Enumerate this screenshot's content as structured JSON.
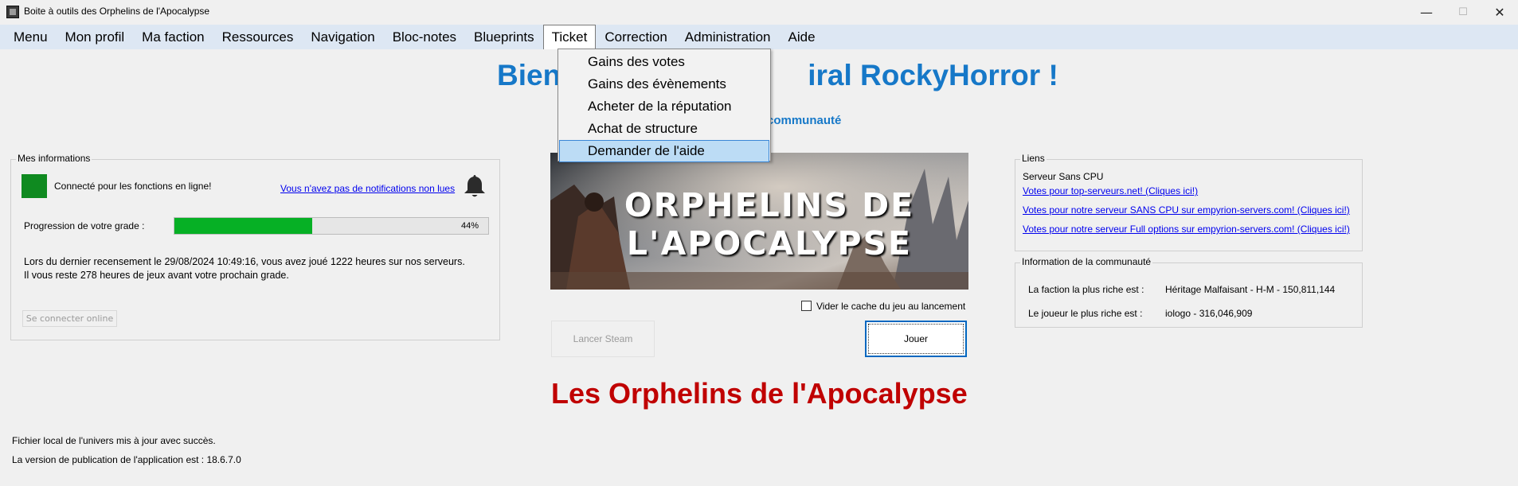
{
  "window": {
    "title": "Boite à outils des Orphelins de l'Apocalypse",
    "minimize": "—",
    "maximize": "☐",
    "close": "✕"
  },
  "menu": [
    "Menu",
    "Mon profil",
    "Ma faction",
    "Ressources",
    "Navigation",
    "Bloc-notes",
    "Blueprints",
    "Ticket",
    "Correction",
    "Administration",
    "Aide"
  ],
  "menu_open": "Ticket",
  "dropdown": {
    "items": [
      "Gains des votes",
      "Gains des évènements",
      "Acheter de la réputation",
      "Achat de structure",
      "Demander de l'aide"
    ],
    "highlighted": "Demander de l'aide"
  },
  "welcome": {
    "visible_start": "Bien",
    "visible_end": "iral RockyHorror !",
    "community_text": "communauté"
  },
  "mes_infos": {
    "title": "Mes informations",
    "status_text": "Connecté pour les fonctions en ligne!",
    "status_color": "#0f8a20",
    "notifications_link": "Vous n'avez pas de notifications non lues",
    "bell_icon": "bell-icon",
    "progress_label": "Progression de votre grade :",
    "progress_percent": 44,
    "progress_text": "44%",
    "census_line1": "Lors du dernier recensement le 29/08/2024 10:49:16, vous avez joué 1222 heures sur nos serveurs.",
    "census_line2": "Il vous reste 278 heures de jeux avant votre prochain grade.",
    "connect_button": "Se connecter online"
  },
  "banner": {
    "line1": "ORPHELINS DE",
    "line2": "L'APOCALYPSE"
  },
  "cache": {
    "label": "Vider le cache du jeu au lancement",
    "checked": false
  },
  "buttons": {
    "steam": "Lancer Steam",
    "play": "Jouer"
  },
  "footer": {
    "title": "Les Orphelins de l'Apocalypse",
    "status": "Fichier local de l'univers mis à jour avec succès.",
    "version": "La version de publication de l'application est : 18.6.7.0"
  },
  "liens": {
    "title": "Liens",
    "server_label": "Serveur Sans CPU",
    "links": [
      "Votes pour top-serveurs.net! (Cliques ici!)",
      "Votes pour notre serveur SANS CPU sur empyrion-servers.com! (Cliques ici!)",
      "Votes pour notre serveur Full options sur empyrion-servers.com! (Cliques ici!)"
    ]
  },
  "communaute": {
    "title": "Information de la communauté",
    "faction_label": "La faction la plus riche est :",
    "faction_value": "Héritage Malfaisant - H-M - 150,811,144",
    "player_label": "Le joueur le plus riche est :",
    "player_value": "iologo - 316,046,909"
  },
  "colors": {
    "accent_blue": "#1678c8",
    "footer_red": "#c00000",
    "progress_green": "#06b025",
    "menubar": "#dde7f3"
  }
}
